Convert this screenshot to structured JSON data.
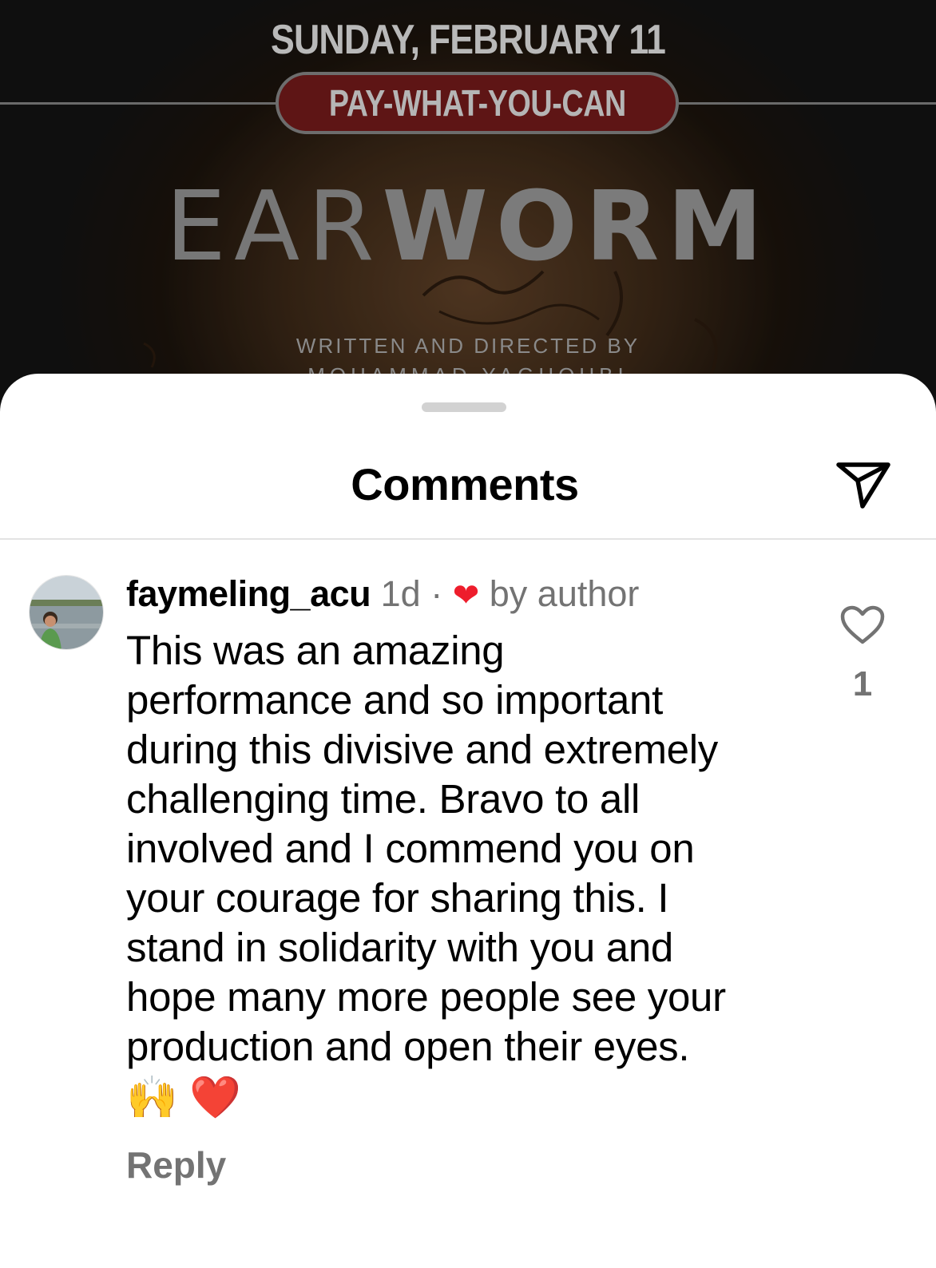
{
  "poster": {
    "date": "SUNDAY, FEBRUARY 11",
    "badge": "PAY-WHAT-YOU-CAN",
    "title_light": "EAR",
    "title_bold": "WORM",
    "credit": "WRITTEN AND DIRECTED BY",
    "director": "MOHAMMAD YAGHOUBI"
  },
  "sheet": {
    "title": "Comments",
    "share_icon": "paper-plane-icon"
  },
  "comment": {
    "username": "faymeling_acu",
    "time": "1d",
    "separator": "·",
    "liked_heart": "❤",
    "liked_label": "by author",
    "text": "This was an amazing\nperformance and so important\nduring this divisive and extremely\nchallenging time. Bravo to all\ninvolved and I commend you on\nyour courage for sharing this. I\nstand in solidarity with you and\nhope many more people see your\nproduction and open their eyes.",
    "emoji_1": "🙌",
    "emoji_2": "❤️",
    "reply_label": "Reply",
    "like_count": "1",
    "like_icon": "heart-outline-icon"
  },
  "colors": {
    "accent_heart": "#ee1d2c",
    "muted_text": "#737373",
    "divider": "#e3e3e3"
  }
}
